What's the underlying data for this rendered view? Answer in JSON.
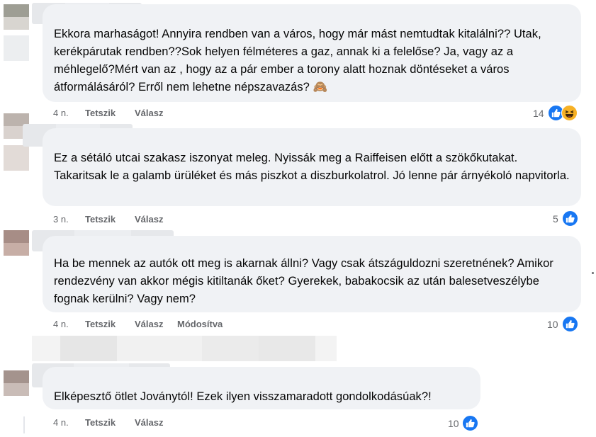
{
  "colors": {
    "bubble": "#f0f2f5",
    "meta_text": "#65676b",
    "like_blue": "#1877f2",
    "haha_yellow": "#f7b125"
  },
  "comments": [
    {
      "text": "Ekkora marhaságot! Annyira rendben van a város, hogy már mást nemtudtak kitalálni?? Utak, kerékpárutak rendben??Sok helyen félméteres a gaz, annak ki a felelőse? Ja, vagy az a méhlegelő?Mért van az , hogy az a pár ember a torony alatt hoznak döntéseket a város átformálásáról? Erről nem lehetne népszavazás? 🙈",
      "time": "4 n.",
      "like_label": "Tetszik",
      "reply_label": "Válasz",
      "reaction_count": "14",
      "reaction_icons": [
        "like-icon",
        "haha-icon"
      ]
    },
    {
      "text": "Ez a sétáló utcai szakasz iszonyat meleg. Nyissák meg a Raiffeisen előtt a szökőkutakat. Takaritsak le a galamb ürüléket és más piszkot a diszburkolatrol. Jó lenne pár árnyékoló napvitorla.",
      "time": "3 n.",
      "like_label": "Tetszik",
      "reply_label": "Válasz",
      "reaction_count": "5",
      "reaction_icons": [
        "like-icon"
      ]
    },
    {
      "text": "Ha be mennek az autók ott meg is akarnak állni? Vagy csak átszáguldozni szeretnének? Amikor rendezvény van akkor mégis kitiltanák őket? Gyerekek, babakocsik az után balesetveszélybe fognak kerülni? Vagy nem?",
      "time": "4 n.",
      "like_label": "Tetszik",
      "reply_label": "Válasz",
      "edited_label": "Módosítva",
      "reaction_count": "10",
      "reaction_icons": [
        "like-icon"
      ]
    },
    {
      "text": "Elképesztő ötlet Joványtól! Ezek ilyen visszamaradott gondolkodásúak?!",
      "time": "4 n.",
      "like_label": "Tetszik",
      "reply_label": "Válasz",
      "reaction_count": "10",
      "reaction_icons": [
        "like-icon"
      ]
    }
  ]
}
